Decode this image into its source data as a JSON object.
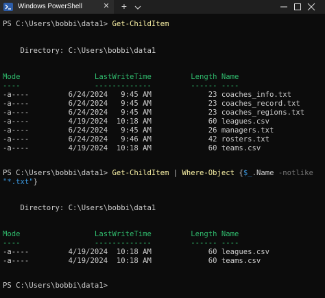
{
  "window": {
    "tab_title": "Windows PowerShell",
    "tab_close_glyph": "✕",
    "new_tab_glyph": "+",
    "icons": [
      "powershell-icon",
      "close-icon",
      "plus-icon",
      "chevron-down-icon",
      "minimize-icon",
      "maximize-icon",
      "close-icon"
    ]
  },
  "terminal": {
    "prompt1": "PS C:\\Users\\bobbi\\data1> ",
    "cmd1": "Get-ChildItem",
    "dir1": "    Directory: C:\\Users\\bobbi\\data1",
    "col_header": "Mode                 LastWriteTime         Length Name",
    "col_rule": "----                 -------------         ------ ----",
    "listing1": [
      "-a----         6/24/2024   9:45 AM             23 coaches_info.txt",
      "-a----         6/24/2024   9:45 AM             23 coaches_record.txt",
      "-a----         6/24/2024   9:45 AM             23 coaches_regions.txt",
      "-a----         4/19/2024  10:18 AM             60 leagues.csv",
      "-a----         6/24/2024   9:45 AM             26 managers.txt",
      "-a----         6/24/2024   9:46 AM             42 rosters.txt",
      "-a----         4/19/2024  10:18 AM             60 teams.csv"
    ],
    "prompt2": "PS C:\\Users\\bobbi\\data1> ",
    "cmd2": {
      "cmdlet": "Get-ChildItem",
      "pipe": " | ",
      "cmdlet2": "Where-Object",
      "brace_open": " {",
      "var": "$_",
      "prop": ".Name",
      "param": " -notlike",
      "string": "\"*.txt\"",
      "brace_close": "}"
    },
    "dir2": "    Directory: C:\\Users\\bobbi\\data1",
    "listing2": [
      "-a----         4/19/2024  10:18 AM             60 leagues.csv",
      "-a----         4/19/2024  10:18 AM             60 teams.csv"
    ],
    "prompt3": "PS C:\\Users\\bobbi\\data1> "
  }
}
